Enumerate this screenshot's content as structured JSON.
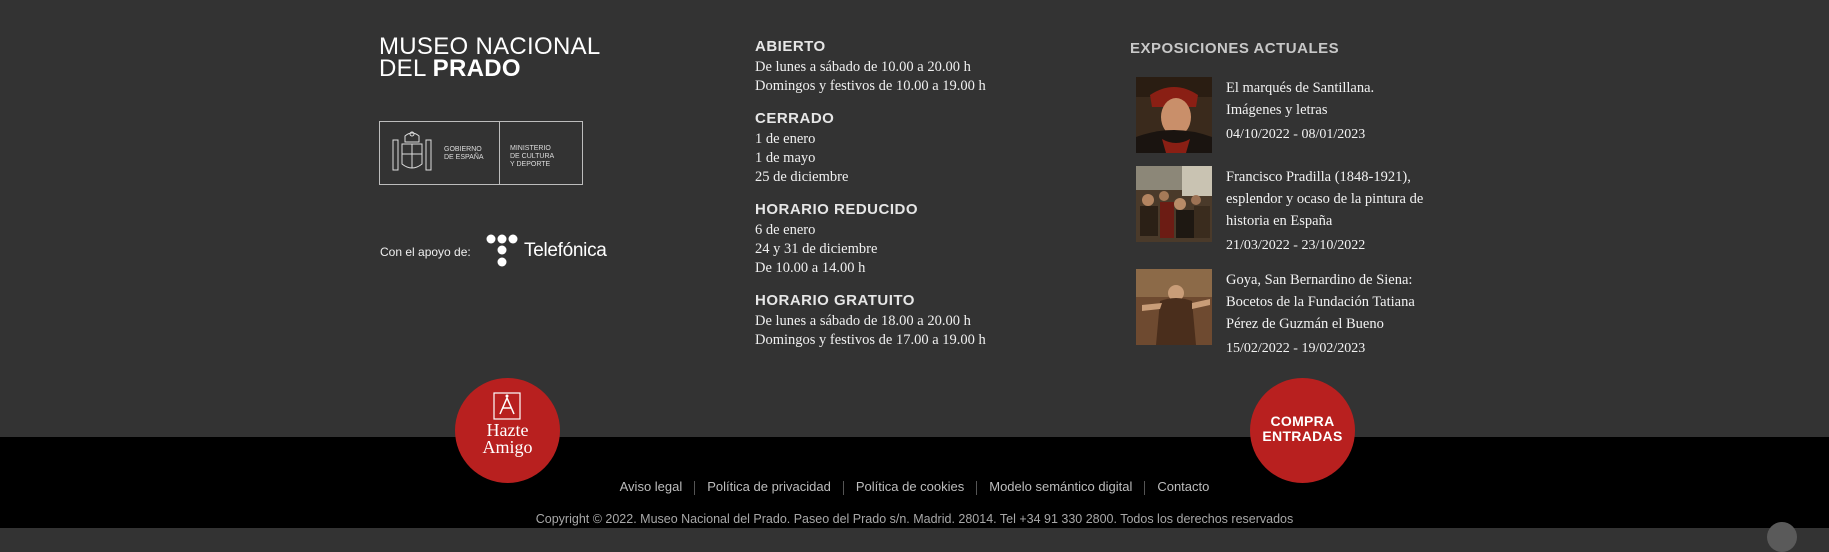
{
  "museum": {
    "name_line1": "MUSEO NACIONAL",
    "name_line2_prefix": "DEL ",
    "name_line2_bold": "PRADO"
  },
  "gov": {
    "gobierno_line1": "GOBIERNO",
    "gobierno_line2": "DE ESPAÑA",
    "ministerio_line1": "MINISTERIO",
    "ministerio_line2": "DE CULTURA",
    "ministerio_line3": "Y DEPORTE"
  },
  "support": {
    "label": "Con el apoyo de:",
    "sponsor": "Telefónica"
  },
  "hours": [
    {
      "heading": "ABIERTO",
      "lines": [
        "De lunes a sábado de 10.00 a 20.00 h",
        "Domingos y festivos de 10.00 a 19.00 h"
      ]
    },
    {
      "heading": "CERRADO",
      "lines": [
        "1 de enero",
        "1 de mayo",
        "25 de diciembre"
      ]
    },
    {
      "heading": "HORARIO REDUCIDO",
      "lines": [
        "6 de enero",
        "24 y 31 de diciembre",
        "De 10.00 a 14.00 h"
      ]
    },
    {
      "heading": "HORARIO GRATUITO",
      "lines": [
        "De lunes a sábado de 18.00 a 20.00 h",
        "Domingos y festivos de 17.00 a 19.00 h"
      ]
    }
  ],
  "exhibitions": {
    "title": "EXPOSICIONES ACTUALES",
    "items": [
      {
        "name_lines": [
          "El marqués de Santillana.",
          "Imágenes y letras"
        ],
        "dates": "04/10/2022 - 08/01/2023"
      },
      {
        "name_lines": [
          "Francisco Pradilla (1848-1921),",
          "esplendor y ocaso de la pintura de",
          "historia en España"
        ],
        "dates": "21/03/2022 - 23/10/2022"
      },
      {
        "name_lines": [
          "Goya, San Bernardino de Siena:",
          "Bocetos de la Fundación Tatiana",
          "Pérez de Guzmán el Bueno"
        ],
        "dates": "15/02/2022 - 19/02/2023"
      }
    ]
  },
  "cta": {
    "amigo_line1": "Hazte",
    "amigo_line2": "Amigo",
    "compra_line1": "COMPRA",
    "compra_line2": "ENTRADAS"
  },
  "footer": {
    "links": [
      "Aviso legal",
      "Política de privacidad",
      "Política de cookies",
      "Modelo semántico digital",
      "Contacto"
    ],
    "copyright": "Copyright © 2022. Museo Nacional del Prado. Paseo del Prado s/n. Madrid. 28014. Tel +34 91 330 2800. Todos los derechos reservados"
  },
  "colors": {
    "background": "#333333",
    "footer_bar": "#000000",
    "accent_red": "#b8201f"
  }
}
